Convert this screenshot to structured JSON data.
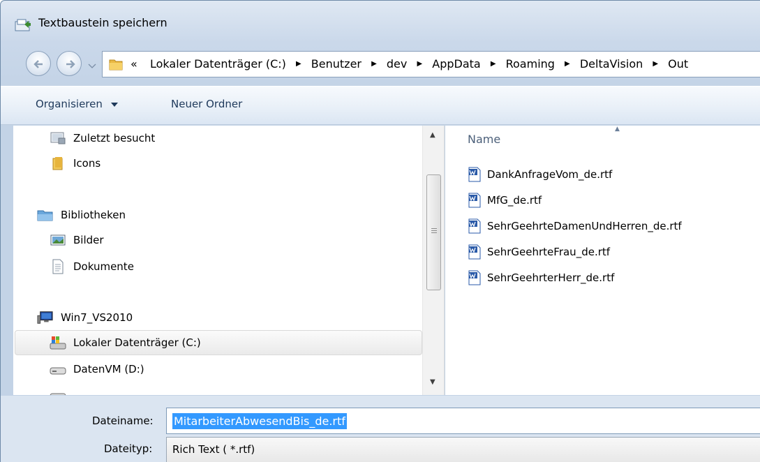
{
  "window": {
    "title": "Textbaustein speichern"
  },
  "address": {
    "overflow": "«",
    "crumbs": [
      "Lokaler Datenträger (C:)",
      "Benutzer",
      "dev",
      "AppData",
      "Roaming",
      "DeltaVision",
      "Out"
    ]
  },
  "toolbar": {
    "organize": "Organisieren",
    "new_folder": "Neuer Ordner"
  },
  "nav": {
    "recent": "Zuletzt besucht",
    "icons": "Icons",
    "libraries": "Bibliotheken",
    "pictures": "Bilder",
    "documents": "Dokumente",
    "computer": "Win7_VS2010",
    "drive_c": "Lokaler Datenträger (C:)",
    "drive_d": "DatenVM (D:)"
  },
  "files": {
    "column_name": "Name",
    "items": [
      "DankAnfrageVom_de.rtf",
      "MfG_de.rtf",
      "SehrGeehrteDamenUndHerren_de.rtf",
      "SehrGeehrteFrau_de.rtf",
      "SehrGeehrterHerr_de.rtf"
    ]
  },
  "form": {
    "filename_label": "Dateiname:",
    "filename_value": "MitarbeiterAbwesendBis_de.rtf",
    "filetype_label": "Dateityp:",
    "filetype_value": "Rich Text  ( *.rtf)"
  },
  "icons": {
    "title": "save-dialog-icon",
    "back": "back-arrow-icon",
    "forward": "forward-arrow-icon",
    "folder": "folder-icon",
    "recent": "recent-places-icon",
    "library": "library-icon",
    "pictures": "pictures-library-icon",
    "document": "document-icon",
    "computer": "computer-icon",
    "drive": "hard-drive-icon",
    "word": "word-document-icon"
  }
}
